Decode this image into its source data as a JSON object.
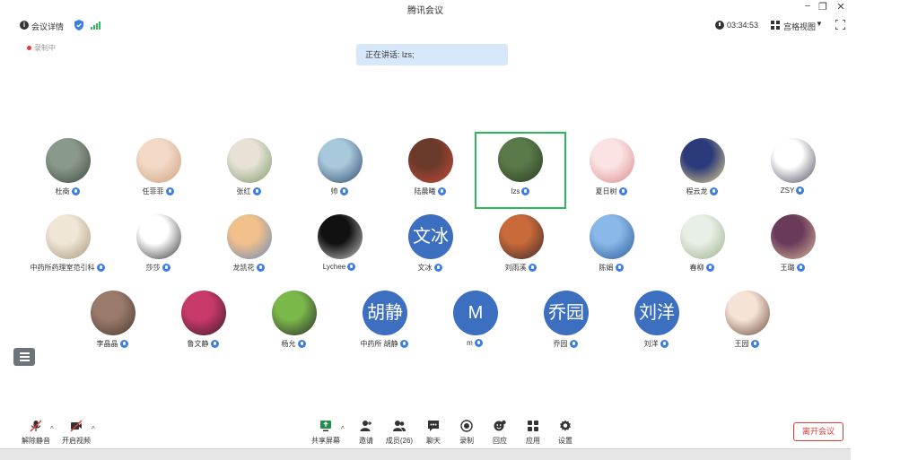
{
  "window": {
    "title": "腾讯会议",
    "controls": [
      "−",
      "❐",
      "✕"
    ]
  },
  "topbar": {
    "meeting_info": "会议详情",
    "timer": "03:34:53",
    "view_mode": "宫格视图"
  },
  "recording": "录制中",
  "speaking_banner": "正在讲话: lzs;",
  "participants": [
    {
      "name": "杜商",
      "avatar": {
        "type": "photo",
        "colors": [
          "#8a9a8a",
          "#3d4a3f"
        ]
      }
    },
    {
      "name": "任菲菲",
      "avatar": {
        "type": "photo",
        "colors": [
          "#f3d9c6",
          "#c9a27e"
        ]
      }
    },
    {
      "name": "张红",
      "avatar": {
        "type": "photo",
        "colors": [
          "#e8e2d6",
          "#7a9a6a"
        ]
      }
    },
    {
      "name": "帅",
      "avatar": {
        "type": "photo",
        "colors": [
          "#a8c8dc",
          "#2f4a6a"
        ]
      }
    },
    {
      "name": "陆晨曦",
      "avatar": {
        "type": "photo",
        "colors": [
          "#6a3a2a",
          "#c84a3a"
        ]
      }
    },
    {
      "name": "lzs",
      "avatar": {
        "type": "photo",
        "colors": [
          "#5a7a4a",
          "#2a3a22"
        ]
      },
      "active": true
    },
    {
      "name": "夏日树",
      "avatar": {
        "type": "photo",
        "colors": [
          "#fbe3e3",
          "#d98a8a"
        ]
      }
    },
    {
      "name": "程云龙",
      "avatar": {
        "type": "photo",
        "colors": [
          "#2a3a7a",
          "#e8d28a"
        ]
      }
    },
    {
      "name": "ZSY",
      "avatar": {
        "type": "photo",
        "colors": [
          "#ffffff",
          "#4a4a5a"
        ]
      }
    },
    {
      "name": "中药所药理室范引科",
      "avatar": {
        "type": "photo",
        "colors": [
          "#efe6d6",
          "#a8967a"
        ]
      }
    },
    {
      "name": "莎莎",
      "avatar": {
        "type": "photo",
        "colors": [
          "#ffffff",
          "#333333"
        ]
      }
    },
    {
      "name": "龙凯花",
      "avatar": {
        "type": "photo",
        "colors": [
          "#f2c08a",
          "#6a8ab8"
        ]
      }
    },
    {
      "name": "Lychee",
      "avatar": {
        "type": "photo",
        "colors": [
          "#111111",
          "#c9c9c9"
        ]
      }
    },
    {
      "name": "文冰",
      "avatar": {
        "type": "text",
        "text": "文冰"
      }
    },
    {
      "name": "刘雨溪",
      "avatar": {
        "type": "photo",
        "colors": [
          "#c96a3a",
          "#3a2a2a"
        ]
      }
    },
    {
      "name": "陈娟",
      "avatar": {
        "type": "photo",
        "colors": [
          "#8ab8e8",
          "#2a5a9a"
        ]
      }
    },
    {
      "name": "春柳",
      "avatar": {
        "type": "photo",
        "colors": [
          "#e8efe6",
          "#9ab08a"
        ]
      }
    },
    {
      "name": "王璐",
      "avatar": {
        "type": "photo",
        "colors": [
          "#6a3a5a",
          "#d8b89a"
        ]
      }
    },
    {
      "name": "李晶晶",
      "avatar": {
        "type": "photo",
        "colors": [
          "#9a7a6a",
          "#4a3a32"
        ]
      }
    },
    {
      "name": "鲁文静",
      "avatar": {
        "type": "photo",
        "colors": [
          "#c83a6a",
          "#3a1a2a"
        ]
      }
    },
    {
      "name": "杨允",
      "avatar": {
        "type": "photo",
        "colors": [
          "#7ab84a",
          "#2a2a2a"
        ]
      }
    },
    {
      "name": "中药所 胡静",
      "avatar": {
        "type": "text",
        "text": "胡静"
      }
    },
    {
      "name": "m",
      "avatar": {
        "type": "text",
        "text": "M"
      }
    },
    {
      "name": "乔园",
      "avatar": {
        "type": "text",
        "text": "乔园"
      }
    },
    {
      "name": "刘洋",
      "avatar": {
        "type": "text",
        "text": "刘洋"
      }
    },
    {
      "name": "王园",
      "avatar": {
        "type": "photo",
        "colors": [
          "#f5e3d6",
          "#6a4a3a"
        ]
      }
    }
  ],
  "toolbar": {
    "unmute": "解除静音",
    "start_video": "开启视频",
    "share_screen": "共享屏幕",
    "invite": "邀请",
    "members": "成员(26)",
    "chat": "聊天",
    "record": "录制",
    "react": "回应",
    "apps": "应用",
    "settings": "设置",
    "leave": "离开会议"
  }
}
